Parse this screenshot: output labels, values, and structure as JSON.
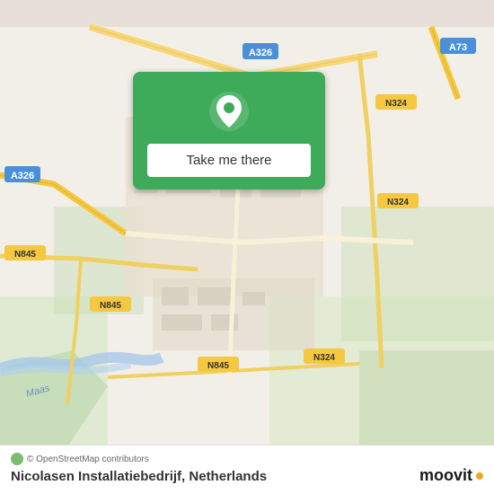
{
  "map": {
    "background_color": "#f2efe9",
    "alt": "Map of Nicolasen Installatiebedrijf, Netherlands"
  },
  "location_card": {
    "button_label": "Take me there",
    "pin_color": "white",
    "card_color": "#3dab5a"
  },
  "bottom_bar": {
    "attribution": "© OpenStreetMap contributors",
    "place_name": "Nicolasen Installatiebedrijf",
    "country": "Netherlands",
    "full_label": "Nicolasen Installatiebedrijf, Netherlands"
  },
  "moovit": {
    "brand": "moovit"
  },
  "road_labels": {
    "a326_top": "A326",
    "a326_left": "A326",
    "a73": "A73",
    "n324_right_top": "N324",
    "n324_right_mid": "N324",
    "n324_bottom": "N324",
    "n845_left": "N845",
    "n845_mid": "N845",
    "n845_bottom": "N845",
    "maas": "Maas"
  }
}
